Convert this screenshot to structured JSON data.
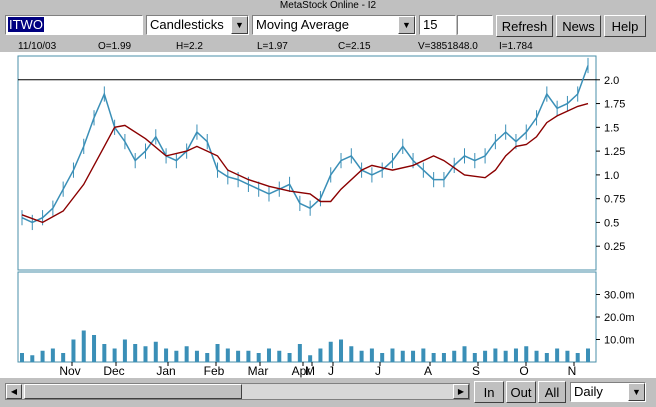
{
  "window": {
    "title": "MetaStock Online - I2"
  },
  "toolbar": {
    "symbol_value": "ITWO",
    "chart_type": "Candlesticks",
    "indicator": "Moving Average",
    "period_value": "15",
    "extra_value": "",
    "refresh_label": "Refresh",
    "news_label": "News",
    "help_label": "Help"
  },
  "quote": {
    "date": "11/10/03",
    "open": "O=1.99",
    "high": "H=2.2",
    "low": "L=1.97",
    "close": "C=2.15",
    "volume": "V=3851848.0",
    "indicator": "I=1.784"
  },
  "chart_data": {
    "type": "candlestick",
    "title": "",
    "price_axis": {
      "ticks": [
        "2.0",
        "1.75",
        "1.5",
        "1.25",
        "1.0",
        "0.75",
        "0.5",
        "0.25"
      ],
      "values": [
        2.0,
        1.75,
        1.5,
        1.25,
        1.0,
        0.75,
        0.5,
        0.25
      ],
      "ylim": [
        0.0,
        2.25
      ],
      "reference_line": 2.0
    },
    "volume_axis": {
      "ticks": [
        "30.0m",
        "20.0m",
        "10.0m"
      ],
      "values": [
        30,
        20,
        10
      ],
      "ylim": [
        0,
        40
      ]
    },
    "x_axis": {
      "labels": [
        "Nov",
        "Dec",
        "Jan",
        "Feb",
        "Mar",
        "Apr",
        "M",
        "J",
        "J",
        "A",
        "S",
        "O",
        "N"
      ],
      "range": [
        "11/2002",
        "11/2003"
      ]
    },
    "series": [
      {
        "name": "",
        "type": "price",
        "points": [
          [
            0,
            0.55
          ],
          [
            1,
            0.5
          ],
          [
            2,
            0.55
          ],
          [
            3,
            0.65
          ],
          [
            4,
            0.85
          ],
          [
            5,
            1.05
          ],
          [
            6,
            1.3
          ],
          [
            7,
            1.6
          ],
          [
            8,
            1.85
          ],
          [
            9,
            1.5
          ],
          [
            10,
            1.35
          ],
          [
            11,
            1.15
          ],
          [
            12,
            1.25
          ],
          [
            13,
            1.4
          ],
          [
            14,
            1.2
          ],
          [
            15,
            1.15
          ],
          [
            16,
            1.25
          ],
          [
            17,
            1.45
          ],
          [
            18,
            1.35
          ],
          [
            19,
            1.05
          ],
          [
            20,
            0.98
          ],
          [
            21,
            0.95
          ],
          [
            22,
            0.9
          ],
          [
            23,
            0.85
          ],
          [
            24,
            0.8
          ],
          [
            25,
            0.85
          ],
          [
            26,
            0.9
          ],
          [
            27,
            0.7
          ],
          [
            28,
            0.65
          ],
          [
            29,
            0.75
          ],
          [
            30,
            1.0
          ],
          [
            31,
            1.15
          ],
          [
            32,
            1.2
          ],
          [
            33,
            1.05
          ],
          [
            34,
            1.0
          ],
          [
            35,
            1.05
          ],
          [
            36,
            1.15
          ],
          [
            37,
            1.3
          ],
          [
            38,
            1.15
          ],
          [
            39,
            1.05
          ],
          [
            40,
            0.95
          ],
          [
            41,
            0.95
          ],
          [
            42,
            1.1
          ],
          [
            43,
            1.2
          ],
          [
            44,
            1.15
          ],
          [
            45,
            1.2
          ],
          [
            46,
            1.35
          ],
          [
            47,
            1.45
          ],
          [
            48,
            1.35
          ],
          [
            49,
            1.45
          ],
          [
            50,
            1.6
          ],
          [
            51,
            1.85
          ],
          [
            52,
            1.7
          ],
          [
            53,
            1.75
          ],
          [
            54,
            1.85
          ],
          [
            55,
            2.15
          ]
        ]
      },
      {
        "name": "",
        "type": "moving-average",
        "points": [
          [
            0,
            0.58
          ],
          [
            2,
            0.5
          ],
          [
            4,
            0.62
          ],
          [
            6,
            0.9
          ],
          [
            8,
            1.3
          ],
          [
            9,
            1.5
          ],
          [
            10,
            1.52
          ],
          [
            12,
            1.38
          ],
          [
            14,
            1.2
          ],
          [
            16,
            1.25
          ],
          [
            17,
            1.3
          ],
          [
            19,
            1.2
          ],
          [
            20,
            1.05
          ],
          [
            22,
            0.95
          ],
          [
            24,
            0.88
          ],
          [
            26,
            0.83
          ],
          [
            28,
            0.8
          ],
          [
            29,
            0.72
          ],
          [
            30,
            0.72
          ],
          [
            31,
            0.85
          ],
          [
            33,
            1.05
          ],
          [
            34,
            1.1
          ],
          [
            36,
            1.05
          ],
          [
            38,
            1.1
          ],
          [
            40,
            1.2
          ],
          [
            41,
            1.15
          ],
          [
            43,
            1.0
          ],
          [
            45,
            0.97
          ],
          [
            46,
            1.05
          ],
          [
            47,
            1.2
          ],
          [
            48,
            1.3
          ],
          [
            49,
            1.32
          ],
          [
            50,
            1.4
          ],
          [
            51,
            1.55
          ],
          [
            52,
            1.62
          ],
          [
            54,
            1.72
          ],
          [
            55,
            1.75
          ]
        ]
      }
    ],
    "volume": [
      4,
      3,
      5,
      6,
      4,
      10,
      14,
      12,
      8,
      6,
      10,
      8,
      7,
      9,
      6,
      5,
      7,
      5,
      4,
      8,
      6,
      5,
      5,
      4,
      6,
      5,
      4,
      8,
      3,
      6,
      9,
      10,
      7,
      5,
      6,
      4,
      6,
      5,
      5,
      6,
      4,
      4,
      5,
      7,
      4,
      5,
      6,
      5,
      6,
      7,
      5,
      4,
      6,
      5,
      4,
      6
    ]
  },
  "footer": {
    "zoom_in_label": "In",
    "zoom_out_label": "Out",
    "all_label": "All",
    "period_select": "Daily"
  },
  "colors": {
    "price_line": "#3a8fb7",
    "ma_line": "#8b0000",
    "selection": "#000080"
  }
}
